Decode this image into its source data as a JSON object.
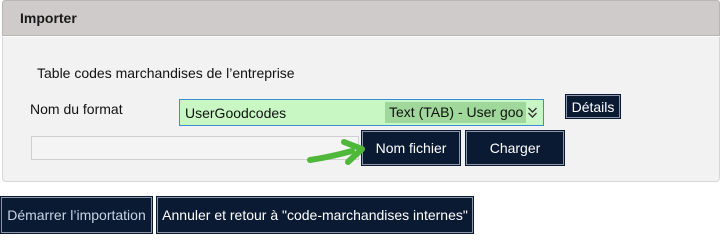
{
  "panel": {
    "title": "Importer",
    "section_label": "Table codes marchandises de l’entreprise",
    "format_label": "Nom du format",
    "format_select": {
      "code": "UserGoodcodes",
      "description": "Text (TAB) - User goo"
    },
    "details_button": "Détails",
    "file_input_value": "",
    "file_button": "Nom fichier",
    "load_button": "Charger"
  },
  "actions": {
    "start_import": "Démarrer l’importation",
    "cancel_return": "Annuler et retour à \"code-marchandises internes\""
  },
  "colors": {
    "header_bg": "#cfcbca",
    "panel_bg": "#f2f2f2",
    "select_bg": "#c8f7c3",
    "select_highlight": "#9fd89a",
    "button_bg": "#0b1a33",
    "arrow": "#4fb83a"
  },
  "icons": {
    "select_arrow": "chevron-down-double-icon",
    "annotation": "green-arrow-icon"
  }
}
